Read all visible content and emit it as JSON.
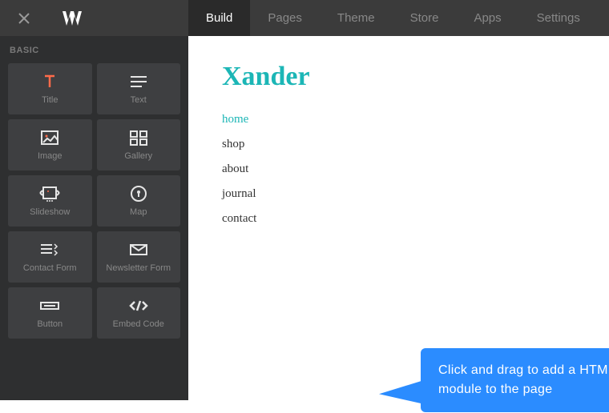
{
  "topbar": {
    "tabs": [
      "Build",
      "Pages",
      "Theme",
      "Store",
      "Apps",
      "Settings"
    ],
    "active_tab": "Build"
  },
  "sidebar": {
    "section_label": "BASIC",
    "widgets": [
      {
        "label": "Title",
        "icon": "title"
      },
      {
        "label": "Text",
        "icon": "text"
      },
      {
        "label": "Image",
        "icon": "image"
      },
      {
        "label": "Gallery",
        "icon": "gallery"
      },
      {
        "label": "Slideshow",
        "icon": "slideshow"
      },
      {
        "label": "Map",
        "icon": "map"
      },
      {
        "label": "Contact Form",
        "icon": "contact-form"
      },
      {
        "label": "Newsletter Form",
        "icon": "newsletter"
      },
      {
        "label": "Button",
        "icon": "button"
      },
      {
        "label": "Embed Code",
        "icon": "embed-code"
      }
    ]
  },
  "canvas": {
    "site_title": "Xander",
    "nav": [
      "home",
      "shop",
      "about",
      "journal",
      "contact"
    ],
    "active_nav": "home"
  },
  "tooltip": {
    "text": "Click and drag to add a HTML module to the page"
  }
}
